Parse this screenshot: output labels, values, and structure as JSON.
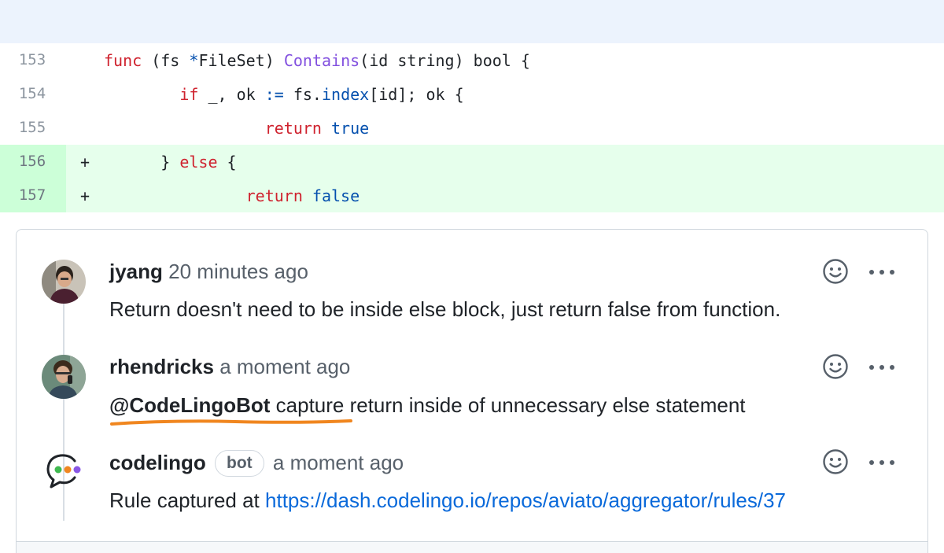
{
  "code": {
    "lines": [
      {
        "num": "153",
        "marker": "",
        "added": false
      },
      {
        "num": "154",
        "marker": "",
        "added": false
      },
      {
        "num": "155",
        "marker": "",
        "added": false
      },
      {
        "num": "156",
        "marker": "+",
        "added": true
      },
      {
        "num": "157",
        "marker": "+",
        "added": true
      }
    ],
    "l153": {
      "func": "func",
      "a": " (fs ",
      "star": "*",
      "type": "FileSet",
      "b": ") ",
      "name": "Contains",
      "c": "(id string) bool {"
    },
    "l154": {
      "if": "if",
      "a": " _, ok ",
      "op": ":=",
      "b": " fs.",
      "field": "index",
      "c": "[id]; ok {"
    },
    "l155": {
      "ret": "return",
      "sp": " ",
      "val": "true"
    },
    "l156": {
      "a": "} ",
      "else": "else",
      "b": " {"
    },
    "l157": {
      "ret": "return",
      "sp": " ",
      "val": "false"
    }
  },
  "comments": [
    {
      "author": "jyang",
      "time": "20 minutes ago",
      "body": "Return doesn't need to be inside else block, just return false from function."
    },
    {
      "author": "rhendricks",
      "time": "a moment ago",
      "mention": "@CodeLingoBot",
      "body": " capture return inside of unnecessary else statement"
    },
    {
      "author": "codelingo",
      "badge": "bot",
      "time": "a moment ago",
      "body": "Rule captured at ",
      "link": "https://dash.codelingo.io/repos/aviato/aggregator/rules/37"
    }
  ],
  "colors": {
    "accent_underline": "#f0861f",
    "added_bg": "#e6ffec",
    "link": "#0969da"
  },
  "icons": [
    "smiley-icon",
    "kebab-menu-icon",
    "codelingo-logo-icon"
  ]
}
